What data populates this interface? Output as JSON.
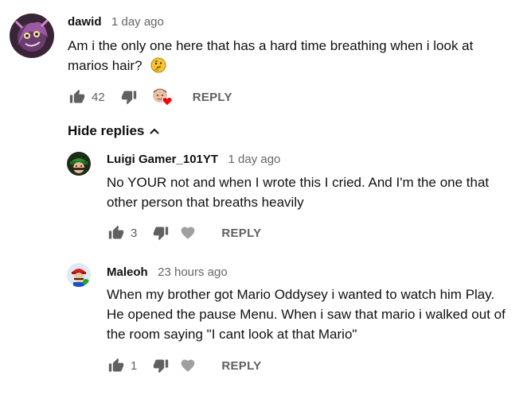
{
  "comments": [
    {
      "author": "dawid",
      "time": "1 day ago",
      "text": "Am i the only one here that has a hard time breathing when i look at marios hair?",
      "emoji": "thinking-face-icon",
      "likes": "42",
      "reply_label": "REPLY",
      "creator_heart": true,
      "hide_replies_label": "Hide replies",
      "replies": [
        {
          "author": "Luigi Gamer_101YT",
          "time": "1 day ago",
          "text_lines": [
            "No YOUR not and when I wrote this I cried. And I'm the one that",
            "other person that breaths heavily"
          ],
          "likes": "3",
          "reply_label": "REPLY"
        },
        {
          "author": "Maleoh",
          "time": "23 hours ago",
          "text_lines": [
            "When my brother got Mario Oddysey i wanted to watch him Play.",
            "He opened the pause Menu. When i saw that mario i walked out of",
            "the room saying \"I cant look at that Mario\""
          ],
          "likes": "1",
          "reply_label": "REPLY"
        }
      ]
    }
  ],
  "colors": {
    "text": "#0f0f0f",
    "muted": "#606060",
    "heart": "#ff0000"
  }
}
